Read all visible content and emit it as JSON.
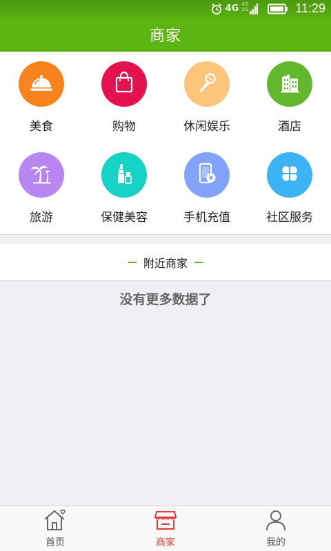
{
  "status_bar": {
    "network": "4G",
    "network_small_top": "4G",
    "network_small_bottom": "2G",
    "time": "11:29",
    "icons": [
      "alarm-icon",
      "signal-icon",
      "battery-icon"
    ]
  },
  "header": {
    "title": "商家"
  },
  "categories": [
    {
      "label": "美食",
      "icon": "food-cloche-icon",
      "color": "#f7821e"
    },
    {
      "label": "购物",
      "icon": "shopping-bag-icon",
      "color": "#e4124f"
    },
    {
      "label": "休闲娱乐",
      "icon": "microphone-icon",
      "color": "#fbc57b"
    },
    {
      "label": "酒店",
      "icon": "hotel-building-icon",
      "color": "#61b82c"
    },
    {
      "label": "旅游",
      "icon": "palm-tree-icon",
      "color": "#b985f0"
    },
    {
      "label": "保健美容",
      "icon": "lipstick-icon",
      "color": "#17d3c7"
    },
    {
      "label": "手机充值",
      "icon": "phone-recharge-icon",
      "color": "#83a3fb"
    },
    {
      "label": "社区服务",
      "icon": "four-leaf-icon",
      "color": "#3cb4f4"
    }
  ],
  "nearby": {
    "title": "附近商家",
    "empty_message": "没有更多数据了"
  },
  "bottom_nav": {
    "items": [
      {
        "label": "首页",
        "icon": "home-icon",
        "active": false
      },
      {
        "label": "商家",
        "icon": "shop-icon",
        "active": true
      },
      {
        "label": "我的",
        "icon": "person-icon",
        "active": false
      }
    ],
    "active_color": "#e03a3a",
    "inactive_color": "#555555"
  },
  "colors": {
    "brand_green": "#5cb513",
    "background": "#efeff4"
  }
}
